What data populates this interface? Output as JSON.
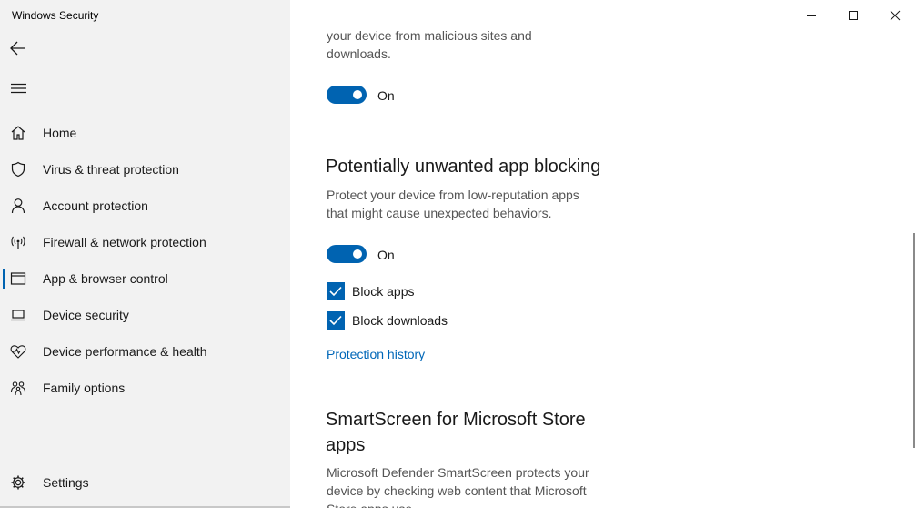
{
  "window": {
    "title": "Windows Security"
  },
  "sidebar": {
    "items": [
      {
        "label": "Home",
        "icon": "home-icon"
      },
      {
        "label": "Virus & threat protection",
        "icon": "shield-icon"
      },
      {
        "label": "Account protection",
        "icon": "person-icon"
      },
      {
        "label": "Firewall & network protection",
        "icon": "antenna-icon"
      },
      {
        "label": "App & browser control",
        "icon": "app-window-icon",
        "selected": true
      },
      {
        "label": "Device security",
        "icon": "laptop-icon"
      },
      {
        "label": "Device performance & health",
        "icon": "heart-pulse-icon"
      },
      {
        "label": "Family options",
        "icon": "family-icon"
      }
    ],
    "settings_label": "Settings"
  },
  "content": {
    "top_desc_line1": "your device from malicious sites and",
    "top_desc_line2": "downloads.",
    "top_toggle_label": "On",
    "pua": {
      "heading": "Potentially unwanted app blocking",
      "desc_line1": "Protect your device from low-reputation apps",
      "desc_line2": "that might cause unexpected behaviors.",
      "toggle_label": "On",
      "block_apps_label": "Block apps",
      "block_downloads_label": "Block downloads",
      "history_link": "Protection history"
    },
    "smartscreen_store": {
      "heading_line1": "SmartScreen for Microsoft Store",
      "heading_line2": "apps",
      "desc_line1": "Microsoft Defender SmartScreen protects your",
      "desc_line2": "device by checking web content that Microsoft",
      "desc_line3": "Store apps use."
    }
  },
  "colors": {
    "accent": "#0063b1",
    "link": "#0067b8",
    "sidebar_bg": "#f2f2f2"
  }
}
